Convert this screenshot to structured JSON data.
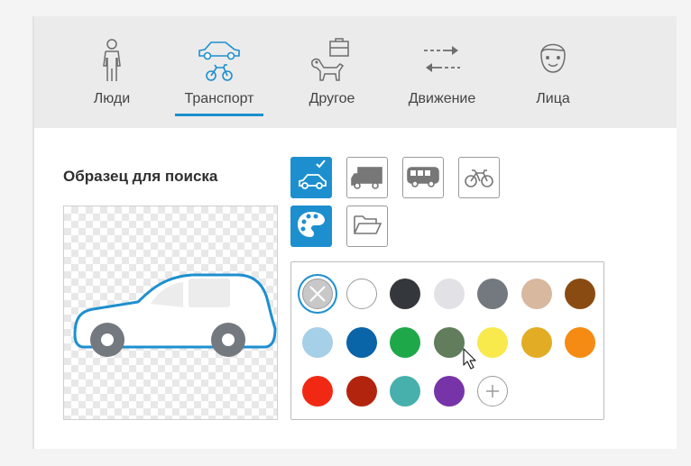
{
  "tabs": [
    {
      "label": "Люди",
      "icon": "person-icon",
      "active": false
    },
    {
      "label": "Транспорт",
      "icon": "transport-icon",
      "active": true
    },
    {
      "label": "Другое",
      "icon": "other-icon",
      "active": false
    },
    {
      "label": "Движение",
      "icon": "motion-arrows-icon",
      "active": false
    },
    {
      "label": "Лица",
      "icon": "face-icon",
      "active": false
    }
  ],
  "search_sample": {
    "title": "Образец для поиска",
    "image": "car-outline"
  },
  "type_buttons": [
    {
      "icon": "car-icon",
      "selected": true
    },
    {
      "icon": "truck-icon",
      "selected": false
    },
    {
      "icon": "bus-icon",
      "selected": false
    },
    {
      "icon": "bicycle-icon",
      "selected": false
    }
  ],
  "tool_buttons": [
    {
      "icon": "palette-icon",
      "active": true
    },
    {
      "icon": "folder-icon",
      "active": false
    }
  ],
  "colors": {
    "accent": "#1d8fcf",
    "swatches": [
      {
        "name": "no-color",
        "hex": "#c8c8c8",
        "selected": true
      },
      {
        "name": "white",
        "hex": "#ffffff"
      },
      {
        "name": "black",
        "hex": "#34373b"
      },
      {
        "name": "light-gray",
        "hex": "#e2e2e6"
      },
      {
        "name": "gray",
        "hex": "#74787f"
      },
      {
        "name": "beige",
        "hex": "#d9b8a0"
      },
      {
        "name": "brown",
        "hex": "#8a4b12"
      },
      {
        "name": "light-blue",
        "hex": "#a6cfe8"
      },
      {
        "name": "blue",
        "hex": "#0a64a8"
      },
      {
        "name": "green",
        "hex": "#1fa84a"
      },
      {
        "name": "olive",
        "hex": "#617d5c"
      },
      {
        "name": "yellow",
        "hex": "#f8e94c"
      },
      {
        "name": "gold",
        "hex": "#e2ad24"
      },
      {
        "name": "orange",
        "hex": "#f68b13"
      },
      {
        "name": "red",
        "hex": "#f12914"
      },
      {
        "name": "dark-red",
        "hex": "#b3240f"
      },
      {
        "name": "teal",
        "hex": "#47b0ad"
      },
      {
        "name": "purple",
        "hex": "#7734a8"
      },
      {
        "name": "add-color",
        "hex": "#ffffff",
        "add": true
      }
    ]
  }
}
